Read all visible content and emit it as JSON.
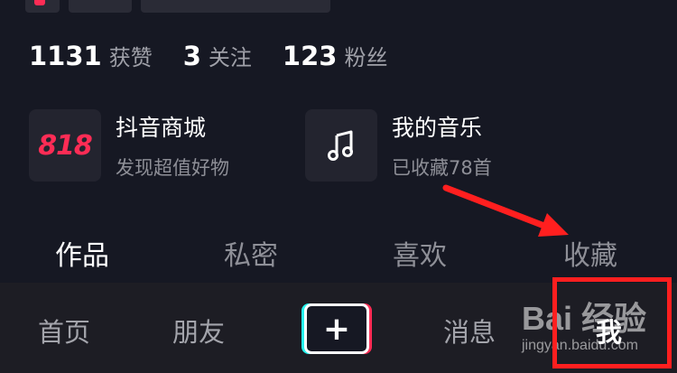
{
  "stats": [
    {
      "num": "1131",
      "label": "获赞"
    },
    {
      "num": "3",
      "label": "关注"
    },
    {
      "num": "123",
      "label": "粉丝"
    }
  ],
  "cards": [
    {
      "title": "抖音商城",
      "subtitle": "发现超值好物",
      "logo": "818"
    },
    {
      "title": "我的音乐",
      "subtitle": "已收藏78首",
      "icon": "music-note-icon"
    }
  ],
  "tabs": [
    "作品",
    "私密",
    "喜欢",
    "收藏"
  ],
  "nav": {
    "home": "首页",
    "friends": "朋友",
    "plus": "+",
    "messages": "消息",
    "me": "我"
  },
  "watermark": {
    "main": "Bai 经验",
    "sub": "jingyan.baidu.com"
  },
  "colors": {
    "background": "#161823",
    "accent": "#fe2c55",
    "annotation": "#ff1f1f"
  }
}
